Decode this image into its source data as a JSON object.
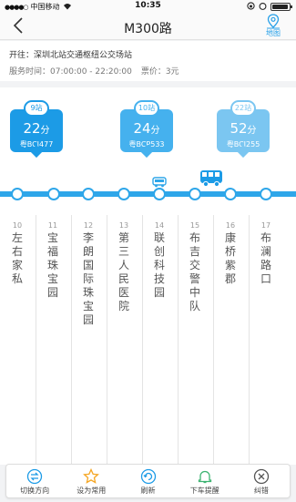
{
  "status_bar": {
    "carrier": "中国移动",
    "time": "10:35"
  },
  "nav": {
    "back_symbol": "〈",
    "title": "M300路",
    "map_label": "地图",
    "accent": "#27a0e8"
  },
  "info": {
    "direction": "开往：深圳北站交通枢纽公交场站",
    "hours": "服务时间：07:00:00 - 22:20:00",
    "fare": "票价：3元"
  },
  "arrivals": [
    {
      "stops": "9站",
      "minutes": "22",
      "unit": "分",
      "plate": "粤BCJ477"
    },
    {
      "stops": "10站",
      "minutes": "24",
      "unit": "分",
      "plate": "粤BCP533"
    },
    {
      "stops": "22站",
      "minutes": "52",
      "unit": "分",
      "plate": "粤BCJ255"
    }
  ],
  "stations": [
    {
      "num": "10",
      "name": [
        "左",
        "右",
        "家",
        "私"
      ]
    },
    {
      "num": "11",
      "name": [
        "宝",
        "福",
        "珠",
        "宝",
        "园"
      ]
    },
    {
      "num": "12",
      "name": [
        "李",
        "朗",
        "国",
        "际",
        "珠",
        "宝",
        "园"
      ]
    },
    {
      "num": "13",
      "name": [
        "第",
        "三",
        "人",
        "民",
        "医",
        "院"
      ]
    },
    {
      "num": "14",
      "name": [
        "联",
        "创",
        "科",
        "技",
        "园"
      ]
    },
    {
      "num": "15",
      "name": [
        "布",
        "吉",
        "交",
        "警",
        "中",
        "队"
      ]
    },
    {
      "num": "16",
      "name": [
        "康",
        "桥",
        "紫",
        "郡"
      ]
    },
    {
      "num": "17",
      "name": [
        "布",
        "澜",
        "路",
        "口"
      ]
    }
  ],
  "tabs": [
    {
      "label": "切换方向",
      "icon": "switch-direction-icon"
    },
    {
      "label": "设为常用",
      "icon": "star-icon"
    },
    {
      "label": "刷新",
      "icon": "refresh-icon"
    },
    {
      "label": "下车提醒",
      "icon": "alarm-clock-icon"
    },
    {
      "label": "纠错",
      "icon": "error-report-icon"
    }
  ],
  "colors": {
    "primary": "#1c9be6",
    "track": "#2ea6e9",
    "star": "#f5a623",
    "alarm": "#3cb371"
  }
}
